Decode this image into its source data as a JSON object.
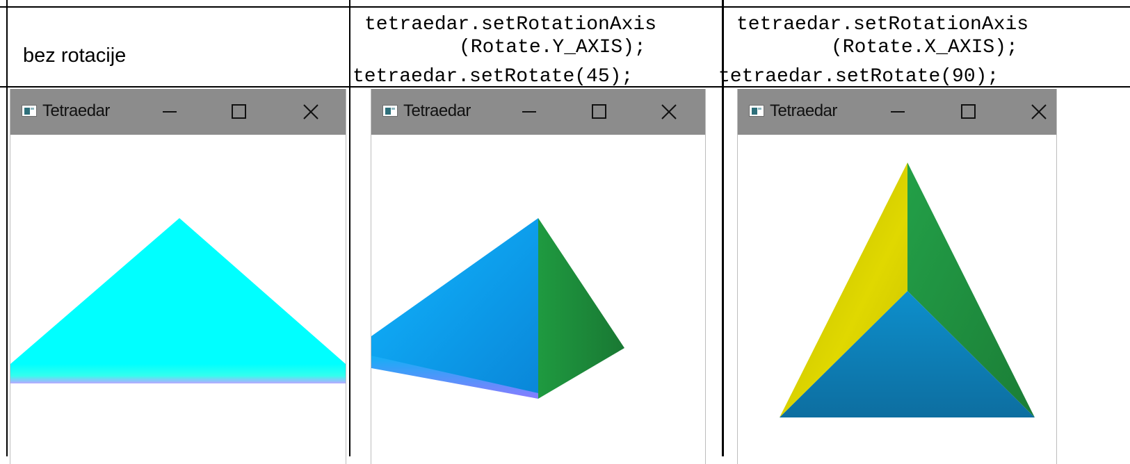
{
  "headers": {
    "col1_label": "bez rotacije",
    "col2_lines": [
      "tetraedar.setRotationAxis",
      "(Rotate.Y_AXIS);",
      "tetraedar.setRotate(45);"
    ],
    "col3_lines": [
      "tetraedar.setRotationAxis",
      "(Rotate.X_AXIS);",
      "tetraedar.setRotate(90);"
    ]
  },
  "windows": [
    {
      "title": "Tetraedar"
    },
    {
      "title": "Tetraedar"
    },
    {
      "title": "Tetraedar"
    }
  ],
  "colors": {
    "titlebar": "#8c8c8c",
    "cyan": "#00ffff",
    "blue": "#0aa6f0",
    "green": "#1f8a3c",
    "yellow": "#d4cc00",
    "dark_blue": "#0d7fb7"
  },
  "icons": [
    "app-window-icon",
    "minimize-icon",
    "maximize-icon",
    "close-icon"
  ]
}
